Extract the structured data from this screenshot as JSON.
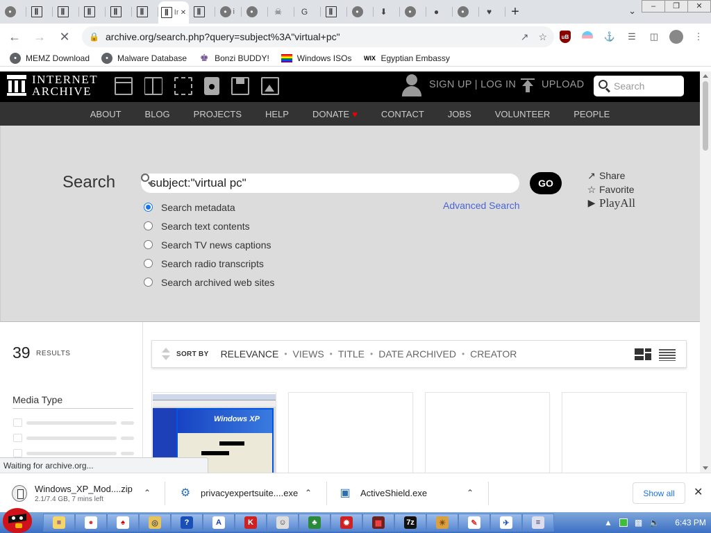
{
  "tabs": [
    {
      "name": "globe",
      "letter": "",
      "active": false
    },
    {
      "name": "ia",
      "letter": "",
      "active": false
    },
    {
      "name": "ia",
      "letter": "",
      "active": false
    },
    {
      "name": "ia",
      "letter": "",
      "active": false
    },
    {
      "name": "ia",
      "letter": "",
      "active": false
    },
    {
      "name": "ia",
      "letter": "",
      "active": false
    },
    {
      "name": "ia",
      "letter": "Ir",
      "active": true
    },
    {
      "name": "ia",
      "letter": "",
      "active": false
    },
    {
      "name": "globe",
      "letter": "i",
      "active": false
    },
    {
      "name": "globe",
      "letter": "",
      "active": false
    },
    {
      "name": "bonzi",
      "letter": "",
      "active": false
    },
    {
      "name": "google",
      "letter": "",
      "active": false
    },
    {
      "name": "ia",
      "letter": "",
      "active": false
    },
    {
      "name": "globe",
      "letter": "",
      "active": false
    },
    {
      "name": "download",
      "letter": "",
      "active": false
    },
    {
      "name": "globe",
      "letter": "",
      "active": false
    },
    {
      "name": "github",
      "letter": "",
      "active": false
    },
    {
      "name": "globe",
      "letter": "",
      "active": false
    },
    {
      "name": "pink",
      "letter": "",
      "active": false
    }
  ],
  "browser": {
    "url": "archive.org/search.php?query=subject%3A\"virtual+pc\"",
    "bookmarks": [
      "MEMZ Download",
      "Malware Database",
      "Bonzi BUDDY!",
      "Windows ISOs",
      "Egyptian Embassy"
    ],
    "status": "Waiting for archive.org..."
  },
  "ia": {
    "logo_line1": "INTERNET",
    "logo_line2": "ARCHIVE",
    "signup": "SIGN UP | LOG IN",
    "upload": "UPLOAD",
    "search_placeholder": "Search",
    "nav": [
      "ABOUT",
      "BLOG",
      "PROJECTS",
      "HELP",
      "DONATE",
      "CONTACT",
      "JOBS",
      "VOLUNTEER",
      "PEOPLE"
    ]
  },
  "search": {
    "title": "Search",
    "query": "subject:\"virtual pc\"",
    "go": "GO",
    "options": [
      {
        "label": "Search metadata",
        "checked": true
      },
      {
        "label": "Search text contents",
        "checked": false
      },
      {
        "label": "Search TV news captions",
        "checked": false
      },
      {
        "label": "Search radio transcripts",
        "checked": false
      },
      {
        "label": "Search archived web sites",
        "checked": false
      }
    ],
    "advanced": "Advanced Search",
    "share": "Share",
    "favorite": "Favorite",
    "playall": "PlayAll"
  },
  "results": {
    "count": "39",
    "count_label": "RESULTS",
    "sort_by": "SORT BY",
    "sort_options": [
      "RELEVANCE",
      "VIEWS",
      "TITLE",
      "DATE ARCHIVED",
      "CREATOR"
    ],
    "media_type": "Media Type"
  },
  "downloads": [
    {
      "name": "Windows_XP_Mod....zip",
      "sub": "2.1/7.4 GB, 7 mins left"
    },
    {
      "name": "privacyexpertsuite....exe",
      "sub": ""
    },
    {
      "name": "ActiveShield.exe",
      "sub": ""
    }
  ],
  "shelf": {
    "show_all": "Show all"
  },
  "taskbar": {
    "clock": "6:43 PM",
    "apps": [
      "folder",
      "chrome",
      "cards",
      "cd",
      "help",
      "A",
      "K",
      "cat",
      "tree",
      "spider",
      "tetris",
      "7z",
      "lion",
      "paint",
      "pinball",
      "notepad"
    ]
  }
}
